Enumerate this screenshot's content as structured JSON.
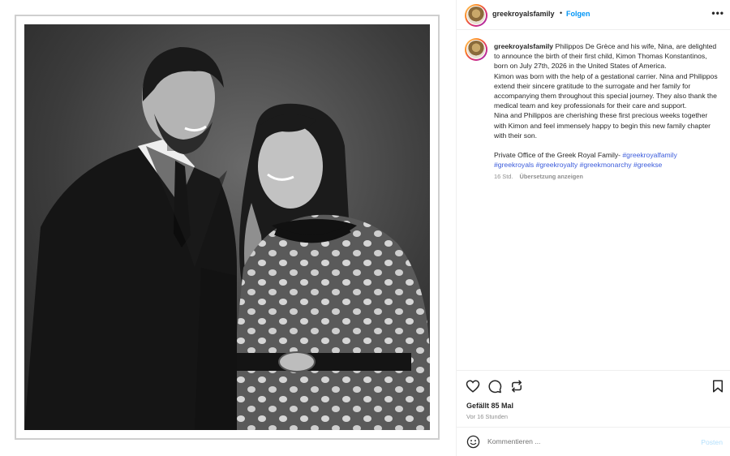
{
  "header": {
    "username": "greekroyalsfamily",
    "separator": "•",
    "follow_label": "Folgen",
    "more_label": "•••"
  },
  "caption": {
    "username": "greekroyalsfamily",
    "paragraph1": "Philippos De Grèce and his wife, Nina, are delighted to announce the birth of their first child, Kimon Thomas Konstantinos, born on July 27th, 2026 in the United States of America.",
    "paragraph2": "Kimon was born with the help of a gestational carrier. Nina and Philippos extend their sincere gratitude to the surrogate and her family for accompanying them throughout this special journey. They also thank the medical team and key professionals for their care and support.",
    "paragraph3": "Nina and Philippos are cherishing these first precious weeks together with Kimon and feel immensely happy to begin this new family chapter with their son.",
    "office_text": "Private Office of the Greek Royal Family- ",
    "hashtags": [
      "#greekroyalfamily",
      "#greekroyals",
      "#greekroyalty",
      "#greekmonarchy",
      "#greekse"
    ],
    "age": "16 Std.",
    "translate_label": "Übersetzung anzeigen"
  },
  "actions": {
    "icons": [
      "heart-icon",
      "comment-icon",
      "share-icon",
      "bookmark-icon"
    ],
    "likes": "Gefällt 85 Mal",
    "timestamp": "Vor 16 Stunden"
  },
  "comment": {
    "placeholder": "Kommentieren ...",
    "post_label": "Posten"
  },
  "colors": {
    "link_blue": "#0095f6",
    "hashtag": "#3b5bdb",
    "muted": "#8e8e8e",
    "border": "#efefef"
  }
}
